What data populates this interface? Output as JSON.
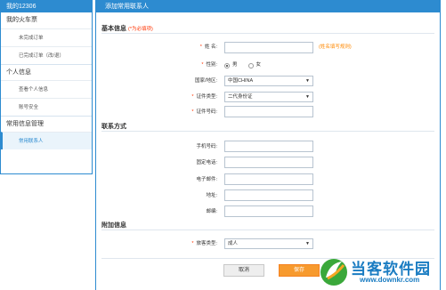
{
  "sidebar": {
    "header": "我的12306",
    "groups": [
      {
        "label": "我的火车票",
        "items": [
          "未完成订单",
          "已完成订单（改/退）"
        ]
      },
      {
        "label": "个人信息",
        "items": [
          "查看个人信息",
          "账号安全"
        ]
      },
      {
        "label": "常用信息管理",
        "items": [
          "常用联系人"
        ]
      }
    ],
    "active_item": "常用联系人"
  },
  "main": {
    "header": "添加常用联系人",
    "basic": {
      "title": "基本信息",
      "required_note": "(*为必填项)",
      "name_label": "姓 名:",
      "name_value": "",
      "name_hint": "(姓名填写规则)",
      "gender_label": "性别:",
      "gender_options": [
        "男",
        "女"
      ],
      "gender_selected": "男",
      "country_label": "国家/地区:",
      "country_value": "中国CHINA",
      "idtype_label": "证件类型:",
      "idtype_value": "二代身份证",
      "idno_label": "证件号码:",
      "idno_value": ""
    },
    "contact": {
      "title": "联系方式",
      "mobile_label": "手机号码:",
      "phone_label": "固定电话:",
      "email_label": "电子邮件:",
      "address_label": "地址:",
      "zip_label": "邮编:"
    },
    "extra": {
      "title": "附加信息",
      "passenger_type_label": "旅客类型:",
      "passenger_type_value": "成人"
    },
    "buttons": {
      "cancel": "取消",
      "save": "保存"
    }
  },
  "watermark": {
    "text": "当客软件园",
    "url": "www.downkr.com"
  },
  "colors": {
    "accent": "#2d8bd0",
    "required": "#ff3300",
    "hint": "#ff8800",
    "save": "#f79a2e"
  }
}
